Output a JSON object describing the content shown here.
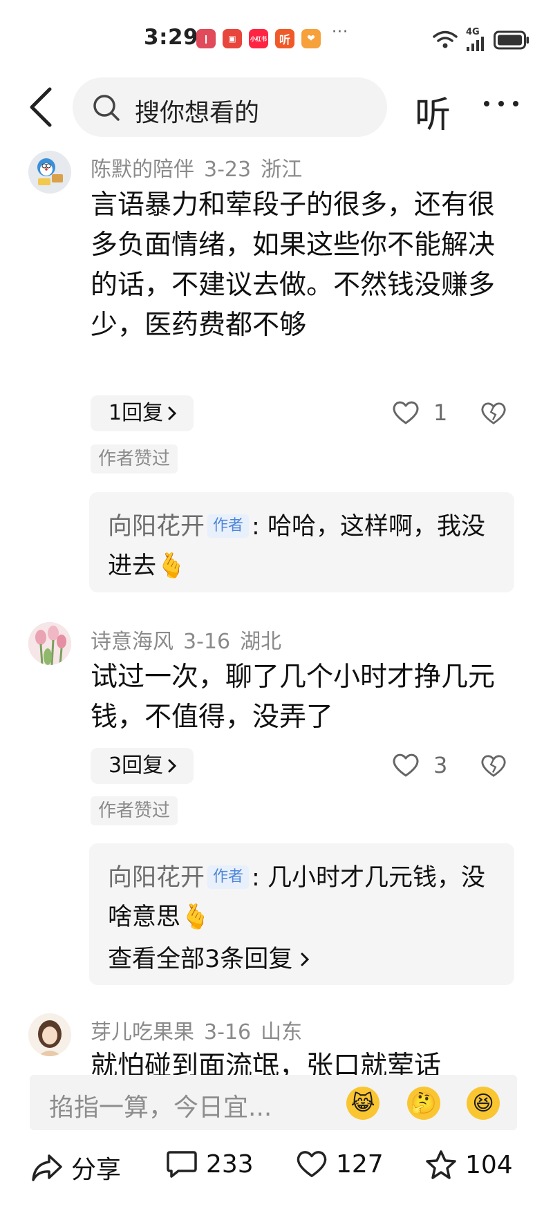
{
  "status_bar": {
    "time": "3:29",
    "app_icons": [
      "❙",
      "▣",
      "小红书",
      "听",
      "❤"
    ],
    "more": "···",
    "network": "4G"
  },
  "nav": {
    "search_placeholder": "搜你想看的",
    "listen_label": "听"
  },
  "comments": [
    {
      "user": "陈默的陪伴",
      "date": "3-23",
      "location": "浙江",
      "text": "言语暴力和荤段子的很多，还有很多负面情绪，如果这些你不能解决的话，不建议去做。不然钱没赚多少，医药费都不够",
      "reply_count_label": "1回复",
      "likes": "1",
      "author_liked": "作者赞过",
      "reply": {
        "name": "向阳花开",
        "tag": "作者",
        "text": "哈哈，这样啊，我没进去",
        "emoji": "🫰"
      }
    },
    {
      "user": "诗意海风",
      "date": "3-16",
      "location": "湖北",
      "text": "试过一次，聊了几个小时才挣几元钱，不值得，没弄了",
      "reply_count_label": "3回复",
      "likes": "3",
      "author_liked": "作者赞过",
      "reply": {
        "name": "向阳花开",
        "tag": "作者",
        "text": "几小时才几元钱，没啥意思",
        "emoji": "🫰",
        "see_all": "查看全部3条回复"
      }
    },
    {
      "user": "芽儿吃果果",
      "date": "3-16",
      "location": "山东",
      "text": "就怕碰到面流氓，张口就荤话"
    }
  ],
  "input": {
    "placeholder": "掐指一算，今日宜...",
    "emojis": [
      "😹",
      "🤔",
      "😆"
    ]
  },
  "actions": {
    "share": "分享",
    "comments": "233",
    "likes": "127",
    "favorites": "104"
  }
}
